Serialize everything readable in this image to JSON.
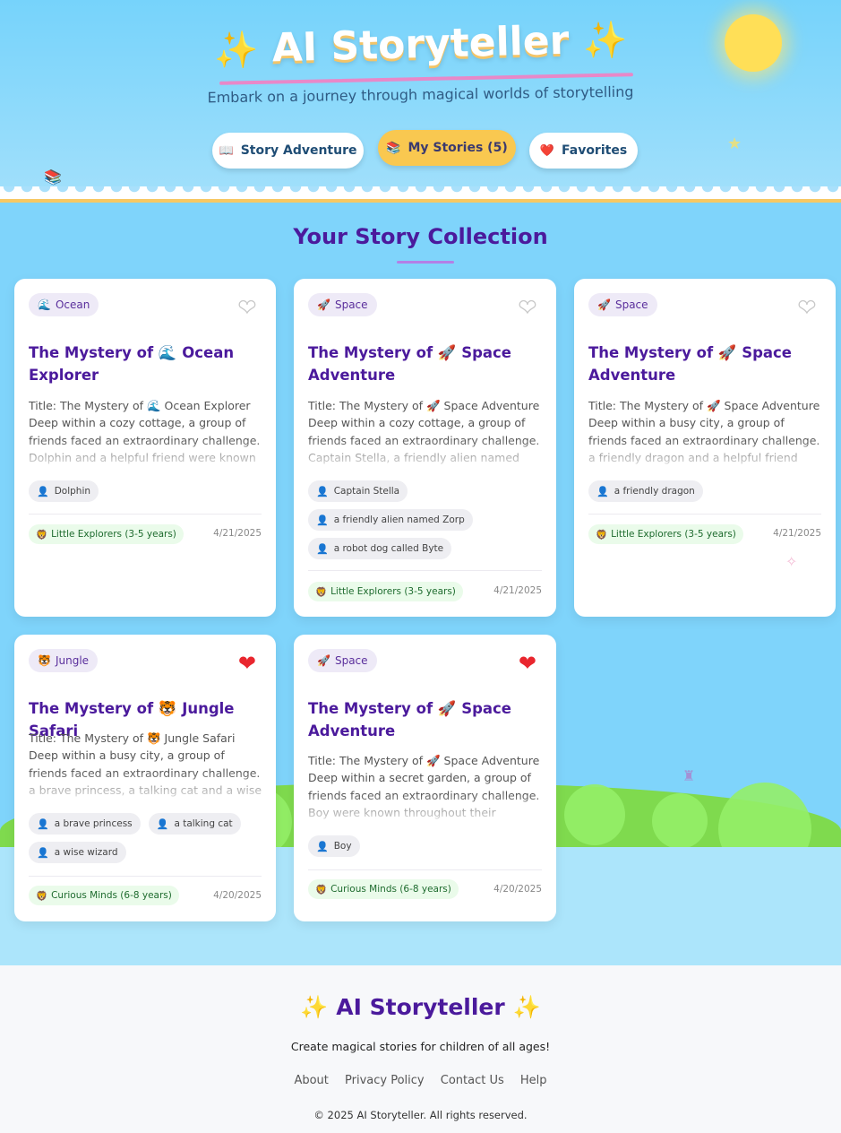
{
  "header": {
    "title": "AI Storyteller",
    "title_spark": "✨",
    "subtitle": "Embark on a journey through magical worlds of storytelling",
    "nav": [
      {
        "label": "Story Adventure",
        "icon": "📖"
      },
      {
        "label": "My Stories (5)",
        "icon": "📚"
      },
      {
        "label": "Favorites",
        "icon": "❤️"
      }
    ]
  },
  "collection": {
    "title": "Your Story Collection",
    "stories": [
      {
        "theme": "Ocean",
        "theme_icon": "🌊",
        "title": "The Mystery of 🌊 Ocean Explorer",
        "body": "Title: The Mystery of 🌊 Ocean Explorer Deep within a cozy cottage, a group of friends faced an extraordinary challenge. Dolphin and a helpful friend were known throughout their community for",
        "characters": [
          "Dolphin"
        ],
        "age_group": "Little Explorers (3-5 years)",
        "date": "4/21/2025",
        "favorite": false
      },
      {
        "theme": "Space",
        "theme_icon": "🚀",
        "title": "The Mystery of 🚀 Space Adventure",
        "body": "Title: The Mystery of 🚀 Space Adventure Deep within a cozy cottage, a group of friends faced an extraordinary challenge. Captain Stella, a friendly alien named Zorp and a robot dog were known",
        "characters": [
          "Captain Stella",
          "a friendly alien named Zorp",
          "a robot dog called Byte"
        ],
        "age_group": "Little Explorers (3-5 years)",
        "date": "4/21/2025",
        "favorite": false
      },
      {
        "theme": "Space",
        "theme_icon": "🚀",
        "title": "The Mystery of 🚀 Space Adventure",
        "body": "Title: The Mystery of 🚀 Space Adventure Deep within a busy city, a group of friends faced an extraordinary challenge. a friendly dragon and a helpful friend were known throughout their community",
        "characters": [
          "a friendly dragon"
        ],
        "age_group": "Little Explorers (3-5 years)",
        "date": "4/21/2025",
        "favorite": false
      },
      {
        "theme": "Jungle",
        "theme_icon": "🐯",
        "title": "The Mystery of 🐯 Jungle Safari",
        "body": "Title: The Mystery of 🐯 Jungle Safari Deep within a busy city, a group of friends faced an extraordinary challenge. a brave princess, a talking cat and a wise wizard were known throughout",
        "characters": [
          "a brave princess",
          "a talking cat",
          "a wise wizard"
        ],
        "age_group": "Curious Minds (6-8 years)",
        "date": "4/20/2025",
        "favorite": true
      },
      {
        "theme": "Space",
        "theme_icon": "🚀",
        "title": "The Mystery of 🚀 Space Adventure",
        "body": "Title: The Mystery of 🚀 Space Adventure Deep within a secret garden, a group of friends faced an extraordinary challenge. Boy were known throughout their community for their kindness",
        "characters": [
          "Boy"
        ],
        "age_group": "Curious Minds (6-8 years)",
        "date": "4/20/2025",
        "favorite": true
      }
    ]
  },
  "footer": {
    "title": "AI Storyteller",
    "spark": "✨",
    "tagline": "Create magical stories for children of all ages!",
    "links": [
      "About",
      "Privacy Policy",
      "Contact Us",
      "Help"
    ],
    "copyright": "© 2025 AI Storyteller. All rights reserved."
  },
  "icons": {
    "age": "🦁",
    "person": "👤",
    "heart": "❤",
    "sun": "sun-icon",
    "star": "★"
  },
  "colors": {
    "accent": "#4b1a9c",
    "sky": "#7fd4fb",
    "active_nav": "#f9c850",
    "favorite_heart": "#e9262e",
    "grass": "#7fda4e"
  }
}
